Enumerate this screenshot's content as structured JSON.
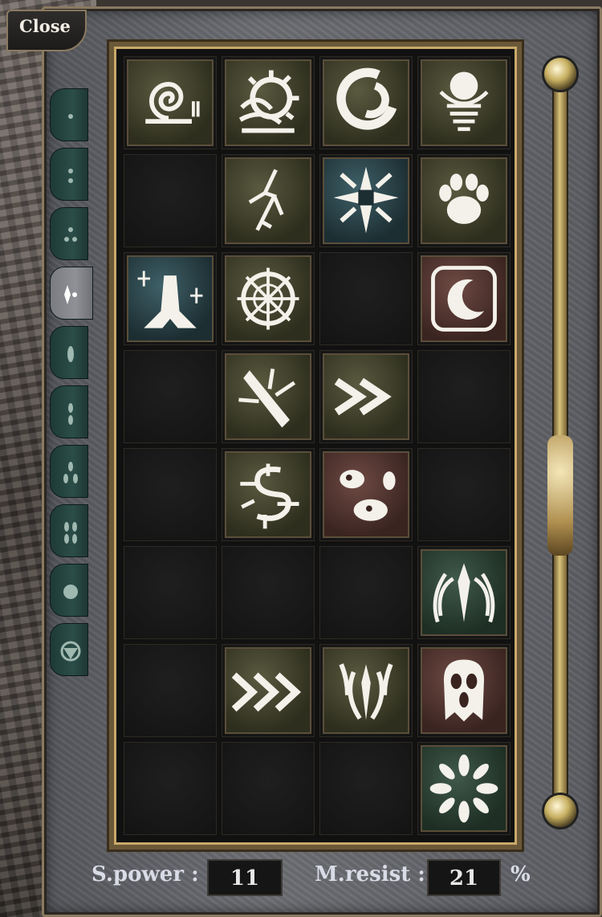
{
  "window": {
    "close_label": "Close"
  },
  "tabs": [
    {
      "icon": "single-dot-icon",
      "active": false
    },
    {
      "icon": "two-dots-icon",
      "active": false
    },
    {
      "icon": "three-dots-icon",
      "active": false
    },
    {
      "icon": "diamond-dot-icon",
      "active": true
    },
    {
      "icon": "ellipse-icon",
      "active": false
    },
    {
      "icon": "two-ellipses-icon",
      "active": false
    },
    {
      "icon": "three-ellipses-icon",
      "active": false
    },
    {
      "icon": "four-ellipses-icon",
      "active": false
    },
    {
      "icon": "circle-icon",
      "active": false
    },
    {
      "icon": "eye-symbol-icon",
      "active": false
    }
  ],
  "grid": {
    "rows": 8,
    "cols": 4,
    "slots": [
      [
        "snail-spell-icon",
        "radiant-sun-spell-icon",
        "swirl-spell-icon",
        "orb-coil-spell-icon"
      ],
      [
        "",
        "lightning-crack-spell-icon",
        "star-burst-spell-icon",
        "paw-spell-icon"
      ],
      [
        "prayer-hands-spell-icon",
        "web-wheel-spell-icon",
        "",
        "moon-frame-spell-icon"
      ],
      [
        "",
        "blade-strike-spell-icon",
        "double-chevron-spell-icon",
        ""
      ],
      [
        "",
        "rune-glyph-spell-icon",
        "boulders-spell-icon",
        ""
      ],
      [
        "",
        "",
        "",
        "winged-crest-spell-icon"
      ],
      [
        "",
        "triple-chevron-spell-icon",
        "tribal-crest-spell-icon",
        "ghost-face-spell-icon"
      ],
      [
        "",
        "",
        "",
        "petal-burst-spell-icon"
      ]
    ]
  },
  "stats": {
    "spower_label": "S.power :",
    "spower_value": "11",
    "mresist_label": "M.resist :",
    "mresist_value": "21",
    "mresist_unit": "%"
  }
}
